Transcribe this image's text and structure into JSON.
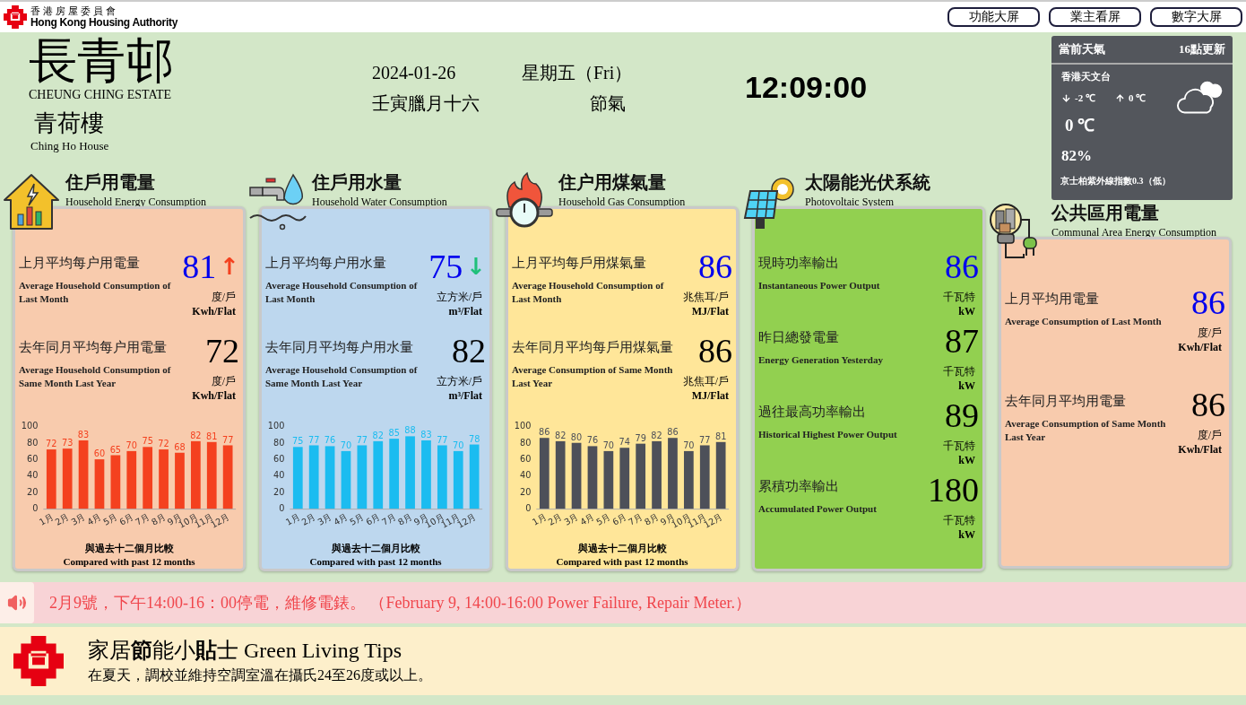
{
  "header": {
    "org_zh": "香港房屋委員會",
    "org_en": "Hong Kong Housing Authority",
    "buttons": [
      "功能大屏",
      "業主看屏",
      "數字大屏"
    ]
  },
  "estate": {
    "name_zh": "長青邨",
    "name_en": "CHEUNG CHING ESTATE",
    "building_zh": "青荷樓",
    "building_en": "Ching Ho House"
  },
  "date": {
    "date": "2024-01-26",
    "weekday": "星期五（Fri）",
    "lunar": "壬寅臘月十六",
    "solar_term": "節氣",
    "time": "12:09:00"
  },
  "weather": {
    "title": "當前天氣",
    "updated": "16點更新",
    "station": "香港天文台",
    "low": "-2 ℃",
    "high": "0 ℃",
    "temperature": "0 ℃",
    "humidity": "82%",
    "uv": "京士柏紫外線指數0.3（低）"
  },
  "panels": [
    {
      "title": "住戶用電量",
      "subtitle": "Household Energy Consumption",
      "color": "#f8cbad",
      "metrics": [
        {
          "label_zh": "上月平均每户用電量",
          "label_en": "Average Household Consumption of Last Month",
          "value": "81",
          "emphasis": true,
          "arrow": "↑",
          "color": "#f4411f",
          "unit_zh": "度/戶",
          "unit_en": "Kwh/Flat"
        },
        {
          "label_zh": "去年同月平均每户用電量",
          "label_en": "Average Household Consumption of Same Month Last Year",
          "value": "72",
          "emphasis": false,
          "unit_zh": "度/戶",
          "unit_en": "Kwh/Flat"
        }
      ],
      "chart_data": {
        "type": "bar",
        "categories": [
          "1月",
          "2月",
          "3月",
          "4月",
          "5月",
          "6月",
          "7月",
          "8月",
          "9月",
          "10月",
          "11月",
          "12月"
        ],
        "series": [
          {
            "color": "#f4411f",
            "values": [
              72,
              73,
              83,
              60,
              65,
              70,
              75,
              72,
              68,
              82,
              81,
              77
            ]
          }
        ],
        "ylim": [
          0,
          100
        ],
        "yticks": [
          0,
          20,
          40,
          60,
          80,
          100
        ],
        "data_labels": true
      },
      "caption_zh": "與過去十二個月比較",
      "caption_en": "Compared with past 12 months"
    },
    {
      "title": "住戶用水量",
      "subtitle": "Household Water Consumption",
      "color": "#bdd7ee",
      "metrics": [
        {
          "label_zh": "上月平均每户用水量",
          "label_en": "Average Household Consumption of Last Month",
          "value": "75",
          "emphasis": true,
          "arrow": "↓",
          "color": "#1fc07a",
          "unit_zh": "立方米/戶",
          "unit_en": "m³/Flat"
        },
        {
          "label_zh": "去年同月平均每户用水量",
          "label_en": "Average Household Consumption of Same Month Last Year",
          "value": "82",
          "emphasis": false,
          "unit_zh": "立方米/戶",
          "unit_en": "m³/Flat"
        }
      ],
      "chart_data": {
        "type": "bar",
        "categories": [
          "1月",
          "2月",
          "3月",
          "4月",
          "5月",
          "6月",
          "7月",
          "8月",
          "9月",
          "10月",
          "11月",
          "12月"
        ],
        "series": [
          {
            "color": "#1bbcf0",
            "values": [
              75,
              77,
              76,
              70,
              77,
              82,
              85,
              88,
              83,
              77,
              70,
              78
            ]
          }
        ],
        "ylim": [
          0,
          100
        ],
        "yticks": [
          0,
          20,
          40,
          60,
          80,
          100
        ],
        "data_labels": true
      },
      "caption_zh": "與過去十二個月比較",
      "caption_en": "Compared with past 12 months"
    },
    {
      "title": "住户用煤氣量",
      "subtitle": "Household Gas Consumption",
      "color": "#ffe699",
      "metrics": [
        {
          "label_zh": "上月平均每戶用煤氣量",
          "label_en": "Average Household Consumption of Last Month",
          "value": "86",
          "emphasis": true,
          "unit_zh": "兆焦耳/戶",
          "unit_en": "MJ/Flat"
        },
        {
          "label_zh": "去年同月平均每戶用煤氣量",
          "label_en": "Average Consumption of Same Month Last Year",
          "value": "86",
          "emphasis": false,
          "unit_zh": "兆焦耳/戶",
          "unit_en": "MJ/Flat"
        }
      ],
      "chart_data": {
        "type": "bar",
        "categories": [
          "1月",
          "2月",
          "3月",
          "4月",
          "5月",
          "6月",
          "7月",
          "8月",
          "9月",
          "10月",
          "11月",
          "12月"
        ],
        "series": [
          {
            "color": "#4d5059",
            "values": [
              86,
              82,
              80,
              76,
              70,
              74,
              79,
              82,
              86,
              70,
              77,
              81
            ]
          }
        ],
        "ylim": [
          0,
          100
        ],
        "yticks": [
          0,
          20,
          40,
          60,
          80,
          100
        ],
        "data_labels": true
      },
      "caption_zh": "與過去十二個月比較",
      "caption_en": "Compared with past 12 months"
    },
    {
      "title": "太陽能光伏系統",
      "subtitle": "Photovoltaic System",
      "color": "#92d050",
      "metrics": [
        {
          "label_zh": "現時功率輸出",
          "label_en": "Instantaneous Power Output",
          "value": "86",
          "emphasis": true,
          "unit_zh": "千瓦特",
          "unit_en": "kW"
        },
        {
          "label_zh": "昨日總發電量",
          "label_en": "Energy Generation Yesterday",
          "value": "87",
          "emphasis": false,
          "unit_zh": "千瓦特",
          "unit_en": "kW"
        },
        {
          "label_zh": "過往最高功率輸出",
          "label_en": "Historical Highest Power Output",
          "value": "89",
          "emphasis": false,
          "unit_zh": "千瓦特",
          "unit_en": "kW"
        },
        {
          "label_zh": "累積功率輸出",
          "label_en": "Accumulated Power Output",
          "value": "180",
          "emphasis": false,
          "unit_zh": "千瓦特",
          "unit_en": "kW"
        }
      ]
    },
    {
      "title": "公共區用電量",
      "subtitle": "Communal Area Energy Consumption",
      "color": "#f8cbad",
      "metrics": [
        {
          "label_zh": "上月平均用電量",
          "label_en": "Average  Consumption of Last Month",
          "value": "86",
          "emphasis": true,
          "unit_zh": "度/戶",
          "unit_en": "Kwh/Flat"
        },
        {
          "label_zh": "去年同月平均用電量",
          "label_en": "Average Consumption of Same Month Last Year",
          "value": "86",
          "emphasis": false,
          "unit_zh": "度/戶",
          "unit_en": "Kwh/Flat"
        }
      ]
    }
  ],
  "notice": "2月9號，下午14:00-16：00停電，維修電錶。 （February 9, 14:00-16:00 Power Failure, Repair Meter.）",
  "tips": {
    "title": "家居**節**能小**貼**士 Green Living Tips",
    "body": "在夏天，調校並維持空調室溫在攝氏24至26度或以上。"
  }
}
